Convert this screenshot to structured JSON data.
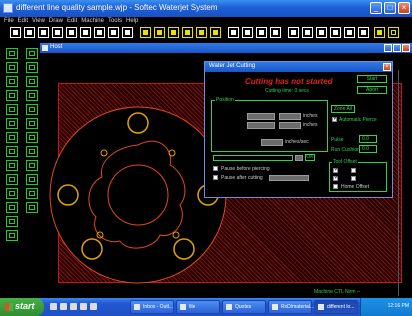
{
  "window": {
    "title": "different line quality sample.wjp - Softec Waterjet System"
  },
  "menu": [
    "File",
    "Edit",
    "View",
    "Draw",
    "Edit",
    "Machine",
    "Tools",
    "Help"
  ],
  "inner_window": {
    "title": "Host"
  },
  "dialog": {
    "title": "Water Jet Cutting",
    "status": "Cutting has not started",
    "time_label": "Cutting time: 0 secs",
    "start_label": "Start",
    "abort_label": "Abort",
    "position_label": "Position",
    "units_x": "inches",
    "units_y": "inches",
    "feed_units": "inches/sec",
    "zone_all_label": "Zone All",
    "auto_pierce_label": "Automatic Pierce",
    "pulse_label": "Pulse",
    "pulse_value": "0.0",
    "run_cushion_label": "Run Cushion",
    "run_cushion_value": "0.0",
    "ok_label": "OK",
    "pause_pierce_label": "Pause before piercing",
    "pause_cutting_label": "Pause after cutting",
    "tool_offset_label": "Tool Offset",
    "home_offset_label": "Home Offset",
    "progress": 0
  },
  "status_bar": {
    "coords": "Machine CTL  Nirm  --"
  },
  "taskbar": {
    "start_label": "start",
    "tasks": [
      "Inbox - Outl...",
      "file",
      "Quotes",
      "RxD/material...",
      "different lo..."
    ],
    "clock": "12:16 PM"
  },
  "colors": {
    "accent_green": "#2fd24a",
    "status_red": "#e02020",
    "hatch_red": "#8a0d0d",
    "titlebar_blue": "#1d5fd6"
  }
}
